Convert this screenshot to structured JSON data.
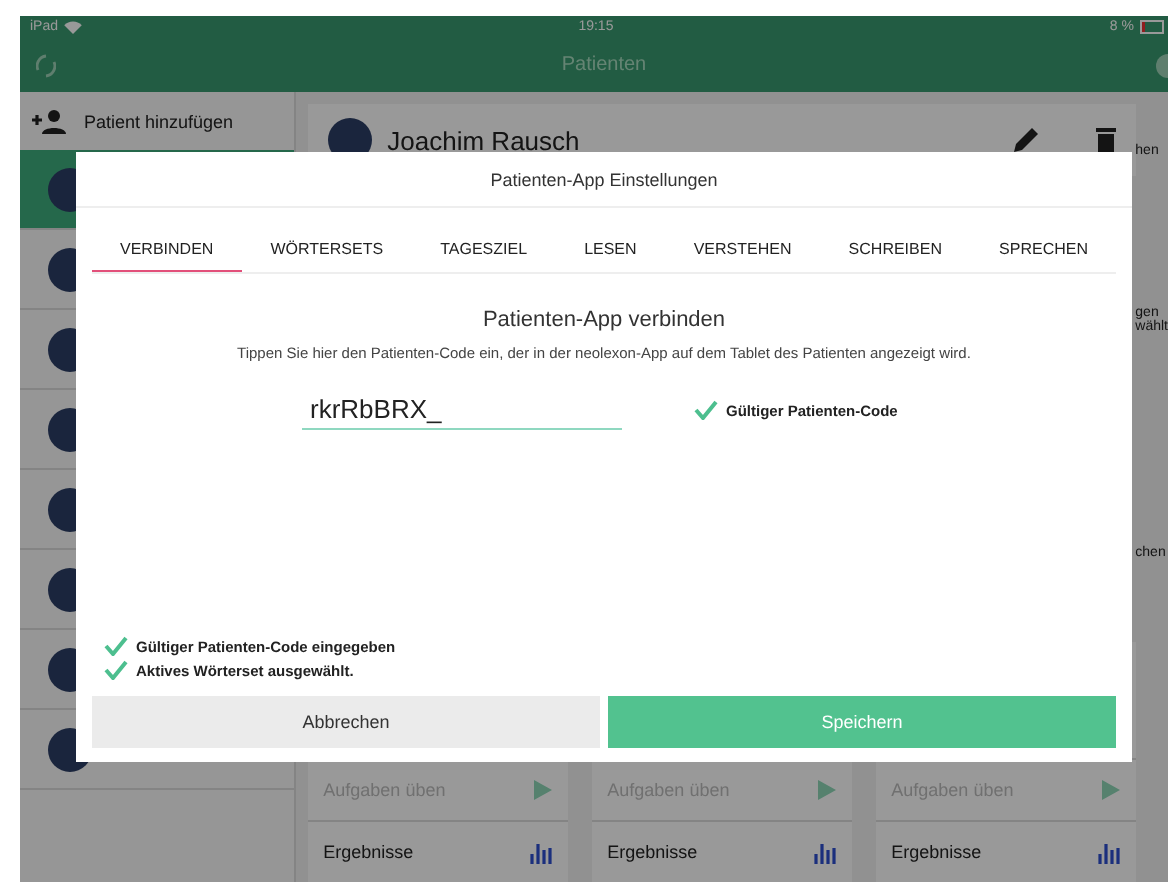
{
  "status_bar": {
    "carrier": "iPad",
    "time": "19:15",
    "battery": "8 %"
  },
  "nav_bar": {
    "title": "Patienten"
  },
  "sidebar": {
    "add_button": "Patient hinzufügen",
    "patients": [
      {
        "selected": true
      },
      {
        "selected": false
      },
      {
        "selected": false
      },
      {
        "selected": false
      },
      {
        "selected": false
      },
      {
        "selected": false
      },
      {
        "selected": false
      },
      {
        "selected": false
      }
    ]
  },
  "main": {
    "patient_name": "Joachim Rausch",
    "edge_texts": [
      "hen",
      "gen",
      "wählt",
      "chen"
    ],
    "cards": [
      {
        "practice": "Aufgaben üben",
        "results": "Ergebnisse"
      },
      {
        "practice": "Aufgaben üben",
        "results": "Ergebnisse"
      },
      {
        "practice": "Aufgaben üben",
        "results": "Ergebnisse"
      }
    ]
  },
  "modal": {
    "title": "Patienten-App Einstellungen",
    "tabs": [
      {
        "label": "VERBINDEN",
        "selected": true
      },
      {
        "label": "WÖRTERSETS",
        "selected": false
      },
      {
        "label": "TAGESZIEL",
        "selected": false
      },
      {
        "label": "LESEN",
        "selected": false
      },
      {
        "label": "VERSTEHEN",
        "selected": false
      },
      {
        "label": "SCHREIBEN",
        "selected": false
      },
      {
        "label": "SPRECHEN",
        "selected": false
      }
    ],
    "heading": "Patienten-App verbinden",
    "description": "Tippen Sie hier den Patienten-Code ein, der in der neolexon-App auf dem Tablet des Patienten angezeigt wird.",
    "code_field": {
      "value": "rkrRbBRX_"
    },
    "validation": {
      "valid": true,
      "text": "Gültiger Patienten-Code"
    },
    "checklist": [
      {
        "text": "Gültiger Patienten-Code eingegeben",
        "checked": true
      },
      {
        "text": "Aktives Wörterset ausgewählt.",
        "checked": true
      }
    ],
    "cancel_button": "Abbrechen",
    "save_button": "Speichern"
  }
}
